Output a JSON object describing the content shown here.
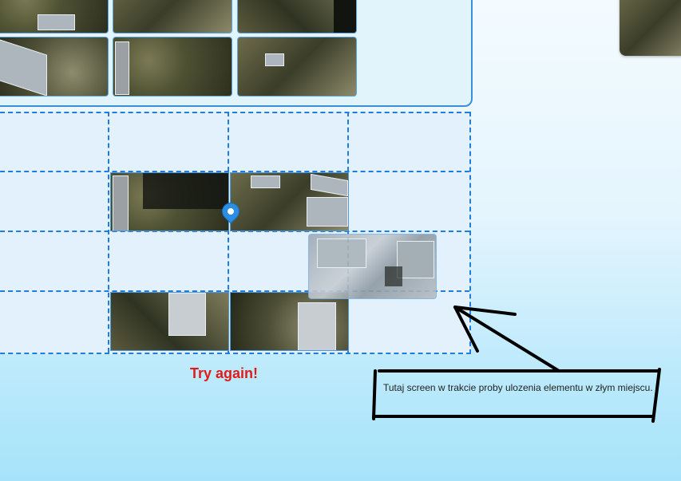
{
  "status": {
    "message": "Try again!",
    "color": "#e11b1b"
  },
  "annotation": {
    "note": "Tutaj screen w trakcie proby ulozenia elementu w złym miejscu."
  },
  "colors": {
    "grid_line": "#1f7de0",
    "tray_border": "#3a8fd9",
    "pin": "#2b8de3"
  },
  "icons": {
    "marker": "location-pin-icon"
  }
}
